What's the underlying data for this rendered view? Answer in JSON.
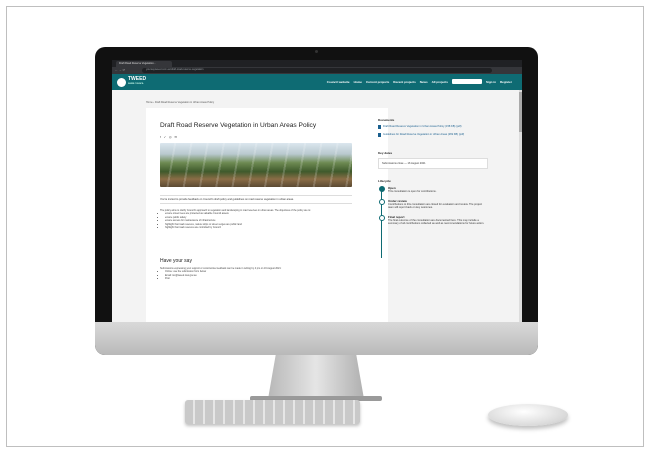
{
  "browser": {
    "tab_title": "Draft Road Reserve Vegetation...",
    "url": "yoursaytweed.com.au/draft-road-reserve-vegetation"
  },
  "site": {
    "logo_text": "TWEED",
    "logo_sub": "SHIRE COUNCIL",
    "nav": [
      "Council website",
      "Home",
      "Current projects",
      "Recent projects",
      "News",
      "All projects",
      "Sign in",
      "Register"
    ]
  },
  "breadcrumb": "Home › Draft Road Reserve Vegetation in Urban Areas Policy",
  "page": {
    "title": "Draft Road Reserve Vegetation in Urban Areas Policy",
    "share_icons": "f  ✓  ◎  ✉",
    "intro": "You're invited to provide feedback on Council's draft policy and guidelines on road reserve vegetation in urban areas.",
    "body_lead": "The policy aims to clarify Council's approach to vegetation and landscaping in road reserves in urban areas. The objectives of the policy are to:",
    "bullets": [
      "ensure street trees are protected as valuable Council assets",
      "ensure public safety",
      "ensure access for maintenance of infrastructure",
      "highlight that road reserves, nature strips or street verges are public land",
      "highlight that road reserves are controlled by Council"
    ],
    "have_say_heading": "Have your say",
    "have_say_text": "Submissions expressing your support or constructive feedback can be made in writing by 4 pm on 16 August 2021:",
    "submit_options": [
      "Online: use the submission form below",
      "Email: tsc@tweed.nsw.gov.au",
      "Post"
    ]
  },
  "sidebar": {
    "documents_heading": "Documents",
    "documents": [
      "Draft Road Reserve Vegetation in Urban Areas Policy (158 KB) (pdf)",
      "Guidelines for Road Reserve Vegetation in Urban Areas (269 KB) (pdf)"
    ],
    "key_dates_heading": "Key dates",
    "key_date": "Submissions close — 16 August 2021",
    "lifecycle_heading": "Lifecycle",
    "stages": [
      {
        "name": "Open",
        "text": "This consultation is open for contributions."
      },
      {
        "name": "Under review",
        "text": "Contributions to this consultation are closed for evaluation and review. The project team will report back on key outcomes."
      },
      {
        "name": "Final report",
        "text": "The final outcome of the consultation are documented here. This may include a summary of all contributions collected as well as recommendations for future action."
      }
    ]
  },
  "colors": {
    "brand": "#0e6b73",
    "link": "#1a5f8e"
  }
}
